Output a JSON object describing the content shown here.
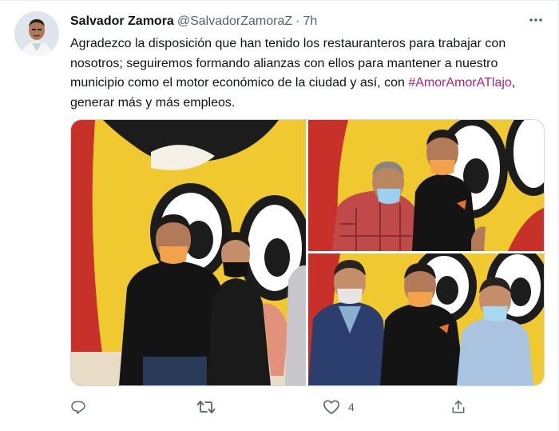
{
  "tweet": {
    "author_name": "Salvador Zamora",
    "handle": "@SalvadorZamoraZ",
    "separator": "·",
    "time": "7h",
    "text_before": "Agradezco la disposición que han tenido los restauranteros para trabajar con nosotros; seguiremos formando alianzas con ellos para mantener a nuestro municipio como el motor económico de la ciudad y así, con ",
    "hashtag": "#AmorAmorATlajo",
    "text_after": ", generar más y más empleos.",
    "hashtag_color": "#b4237a"
  },
  "actions": {
    "reply_count": "",
    "retweet_count": "",
    "like_count": "4",
    "icons": [
      "reply-icon",
      "retweet-icon",
      "like-icon",
      "share-icon"
    ]
  },
  "theme": {
    "mural_yellow": "#f0c830",
    "mural_red": "#c8302a",
    "mask_orange": "#f2a24a",
    "text_secondary": "#536471"
  }
}
